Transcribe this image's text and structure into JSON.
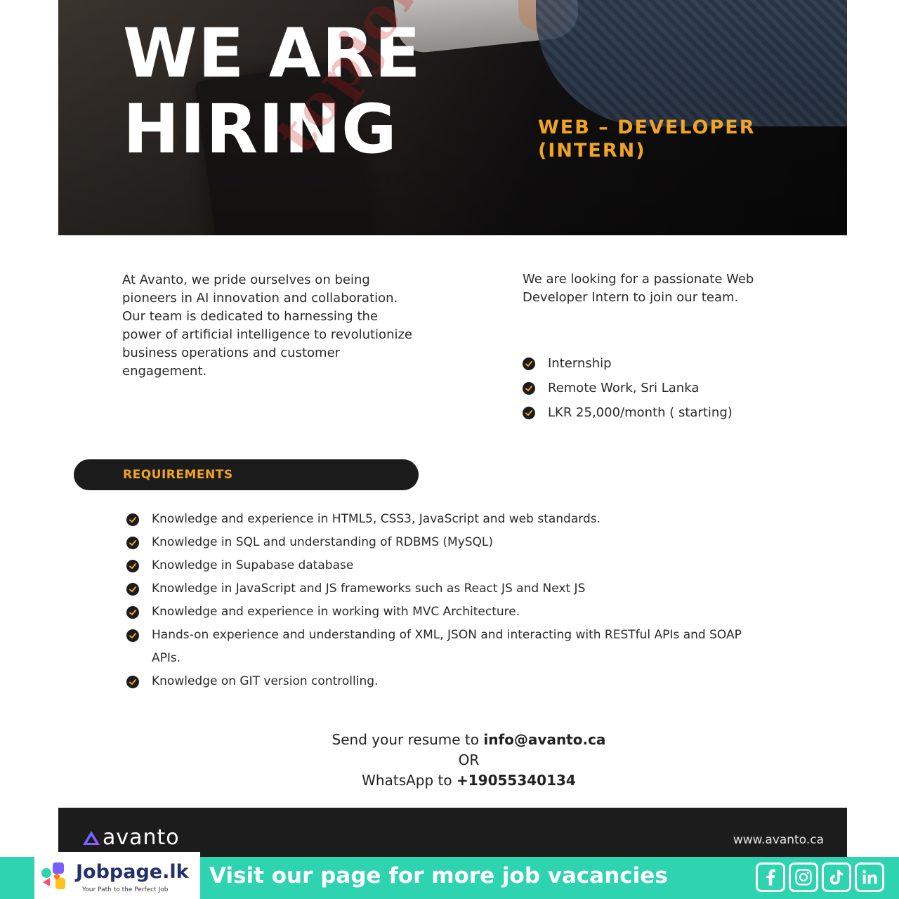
{
  "hero": {
    "title_line1": "WE ARE",
    "title_line2": "HIRING",
    "role_line1": "WEB – DEVELOPER",
    "role_line2": "(INTERN)",
    "watermark": "topjobs.lk"
  },
  "intro": {
    "left_text": "At Avanto, we pride ourselves on being pioneers in AI innovation and collaboration. Our team is dedicated to harnessing the power of artificial intelligence to revolutionize business operations and customer engagement.",
    "right_text": "We are looking for a passionate Web Developer Intern to join our team.",
    "features": [
      "Internship",
      "Remote Work, Sri Lanka",
      "LKR 25,000/month ( starting)"
    ]
  },
  "requirements": {
    "heading": "REQUIREMENTS",
    "items": [
      "Knowledge and experience in HTML5, CSS3, JavaScript and web standards.",
      "Knowledge in SQL and understanding of RDBMS (MySQL)",
      "Knowledge in Supabase database",
      "Knowledge in JavaScript and JS frameworks such as React JS and Next JS",
      "Knowledge and experience in working with MVC Architecture.",
      "Hands-on experience and understanding of XML, JSON and interacting with RESTful APIs and SOAP APIs.",
      "Knowledge on GIT version controlling."
    ]
  },
  "contact": {
    "resume_prefix": "Send your resume to ",
    "email": "info@avanto.ca",
    "or": "OR",
    "whatsapp_prefix": "WhatsApp to ",
    "phone": "+19055340134"
  },
  "footer": {
    "brand": "avanto",
    "website": "www.avanto.ca"
  },
  "jobpage": {
    "name": "Jobpage.lk",
    "tagline": "Your Path to the Perfect Job",
    "cta": "Visit our page for more job vacancies",
    "socials": [
      "facebook-icon",
      "instagram-icon",
      "tiktok-icon",
      "linkedin-icon"
    ]
  },
  "colors": {
    "accent": "#f0a425",
    "dark": "#1c1c1c",
    "jobpage_bar": "#2ed3b0"
  }
}
